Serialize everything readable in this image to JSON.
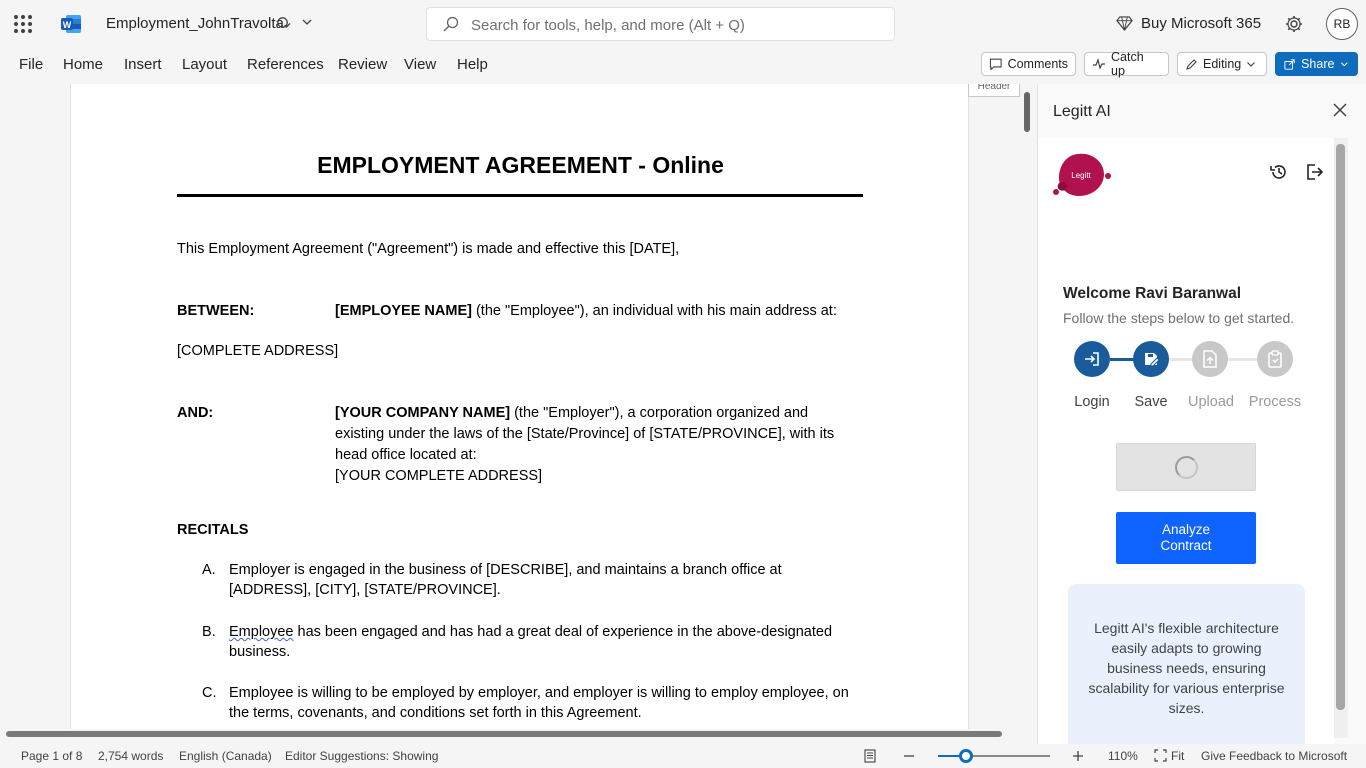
{
  "titlebar": {
    "doc_title": "Employment_JohnTravolta",
    "search_placeholder": "Search for tools, help, and more (Alt + Q)",
    "buy_label": "Buy Microsoft 365",
    "avatar_initials": "RB"
  },
  "menu": {
    "items": [
      "File",
      "Home",
      "Insert",
      "Layout",
      "References",
      "Review",
      "View",
      "Help"
    ],
    "comments": "Comments",
    "catchup": "Catch up",
    "editing": "Editing",
    "share": "Share"
  },
  "document": {
    "header_tab": "Header",
    "title": "EMPLOYMENT AGREEMENT - Online",
    "intro": "This Employment Agreement (\"Agreement\") is made and effective this [DATE],",
    "between_label": "BETWEEN:",
    "employee_name": "[EMPLOYEE NAME]",
    "employee_rest": " (the \"Employee\"), an individual with his main address at:",
    "complete_address": "[COMPLETE ADDRESS]",
    "and_label": "AND:",
    "company_name": "[YOUR COMPANY NAME]",
    "company_rest_1": " (the \"Employer\"), a corporation organized and",
    "company_rest_2": "existing under the laws of the [State/Province] of [STATE/PROVINCE], with its",
    "company_rest_3": "head office located at:",
    "company_address": "[YOUR COMPLETE ADDRESS]",
    "recitals_label": "RECITALS",
    "recitals": [
      {
        "marker": "A.",
        "line1": "Employer is engaged in the business of [DESCRIBE], and maintains a branch office at",
        "line2": "[ADDRESS], [CITY], [STATE/PROVINCE]."
      },
      {
        "marker": "B.",
        "line1_word": "Employee",
        "line1_rest": " has been engaged and has had a great deal of experience in the above-designated",
        "line2": "business."
      },
      {
        "marker": "C.",
        "line1": "Employee is willing to be employed by employer, and employer is willing to employ employee, on",
        "line2": "the terms, covenants, and conditions set forth in this Agreement."
      }
    ]
  },
  "pane": {
    "title": "Legitt AI",
    "logo_text": "Legitt",
    "welcome": "Welcome Ravi Baranwal",
    "follow": "Follow the steps below to get started.",
    "steps": [
      "Login",
      "Save",
      "Upload",
      "Process"
    ],
    "analyze_label": "Analyze Contract",
    "info": "Legitt AI's flexible architecture easily adapts to growing business needs, ensuring scalability for various enterprise sizes.",
    "colors": {
      "active": "#1a5b9c",
      "inactive": "#c8c8c8",
      "button": "#0f63ff",
      "card": "#eaf1fd",
      "logo": "#b1124f"
    }
  },
  "status": {
    "page": "Page 1 of 8",
    "words": "2,754 words",
    "language": "English (Canada)",
    "editor": "Editor Suggestions: Showing",
    "zoom": "110%",
    "fit": "Fit",
    "feedback": "Give Feedback to Microsoft"
  }
}
